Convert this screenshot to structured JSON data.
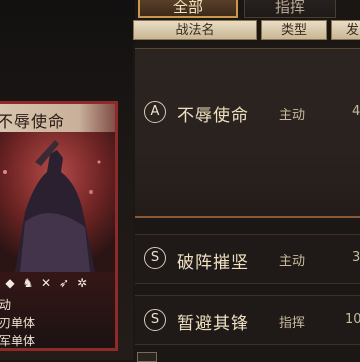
{
  "tabs": {
    "all": "全部",
    "command": "指挥"
  },
  "columns": {
    "name": "战法名",
    "type": "类型",
    "extra": "发"
  },
  "card": {
    "title": "不辱使命",
    "lines": [
      "动",
      "刃单体",
      "军单体"
    ]
  },
  "tactics": [
    {
      "grade": "A",
      "name": "不辱使命",
      "type": "主动",
      "value": "4"
    },
    {
      "grade": "S",
      "name": "破阵摧坚",
      "type": "主动",
      "value": "3"
    },
    {
      "grade": "S",
      "name": "暂避其锋",
      "type": "指挥",
      "value": "10"
    }
  ],
  "colors": {
    "accent": "#c9974e",
    "card_border": "#8e2a27",
    "text": "#efe0c2"
  }
}
